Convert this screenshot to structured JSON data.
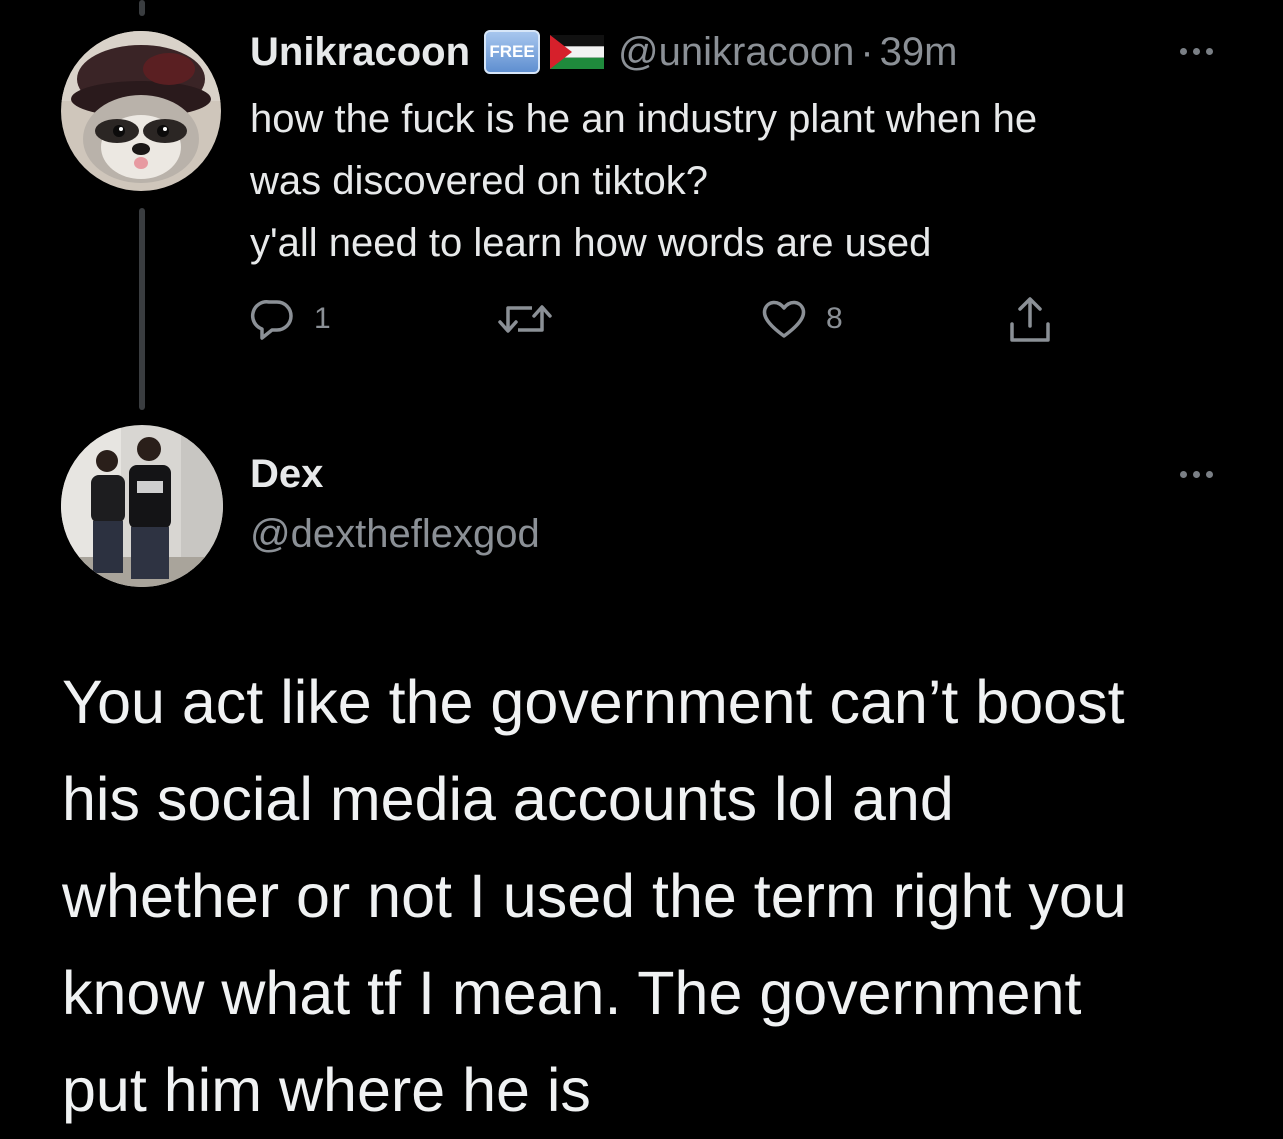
{
  "tweet1": {
    "display_name": "Unikracoon",
    "badge": "FREE",
    "flag_icon": "palestine-flag-icon",
    "handle": "@unikracoon",
    "separator": "·",
    "time": "39m",
    "lines": [
      "how the fuck is he an industry plant when he",
      "was discovered on tiktok?",
      "y'all need to learn how words are used"
    ],
    "actions": {
      "reply_count": "1",
      "retweet_count": "",
      "like_count": "8"
    }
  },
  "tweet2": {
    "display_name": "Dex",
    "handle": "@dextheflexgod",
    "lines": [
      "You act like the government can’t boost",
      "his social media accounts lol and",
      "whether or not I used the term right you",
      "know what tf I mean. The government",
      "put him where he is"
    ]
  },
  "colors": {
    "background": "#000000",
    "primary_text": "#e7e9ea",
    "secondary_text": "#8b9096",
    "thread_line": "#3a3d40"
  }
}
